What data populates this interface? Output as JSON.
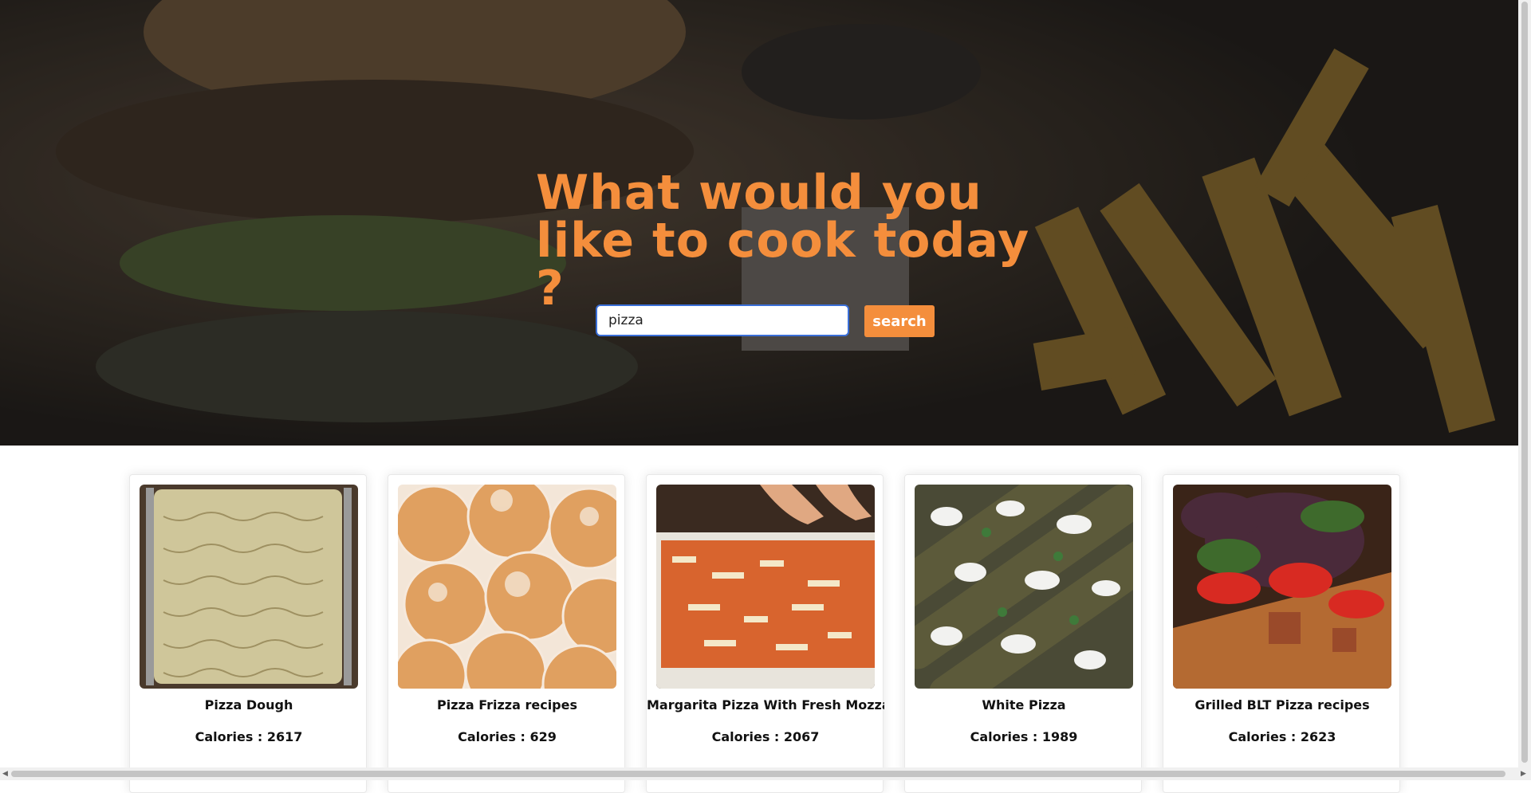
{
  "hero": {
    "title": "What would you like to cook today ?",
    "image_icon": "burger-fries-photo"
  },
  "search": {
    "value": "pizza",
    "button_label": "search"
  },
  "cards": [
    {
      "title": "Pizza Dough",
      "calories": "Calories : 2617",
      "image_icon": "pizza-dough-photo"
    },
    {
      "title": "Pizza Frizza recipes",
      "calories": "Calories : 629",
      "image_icon": "fried-dough-balls-photo"
    },
    {
      "title": "Margarita Pizza With Fresh Mozzarel",
      "calories": "Calories : 2067",
      "image_icon": "margarita-pizza-photo"
    },
    {
      "title": "White Pizza",
      "calories": "Calories : 1989",
      "image_icon": "white-pizza-photo"
    },
    {
      "title": "Grilled BLT Pizza recipes",
      "calories": "Calories : 2623",
      "image_icon": "blt-pizza-photo"
    }
  ],
  "colors": {
    "accent": "#f48e3c",
    "input_border": "#3a6fd8"
  }
}
